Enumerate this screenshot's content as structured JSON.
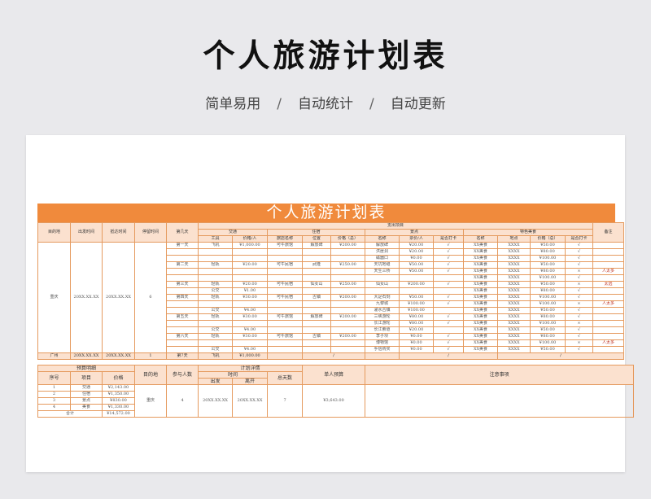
{
  "banner": {
    "title": "个人旅游计划表",
    "subtitle_items": [
      "简单易用",
      "自动统计",
      "自动更新"
    ],
    "separator": "/"
  },
  "doc": {
    "title": "个人旅游计划表",
    "headers": {
      "destination": "目的地",
      "depart_time": "出发时间",
      "arrive_time": "抵达时间",
      "stay_time": "停留时间",
      "day_no": "第几天",
      "expense": "支出项目",
      "transport": "交通",
      "lodging": "住宿",
      "scenic": "景点",
      "food": "特色美食",
      "note": "备注",
      "tool": "工具",
      "price_per": "价格/人",
      "hotel_name": "旅店名称",
      "location": "位置",
      "price_total": "价格（总）",
      "name": "名称",
      "ticket_per": "票价/人",
      "checked_in": "是否打卡",
      "place": "地点"
    },
    "group": {
      "destination": "重庆",
      "depart": "20XX.XX.XX",
      "arrive": "20XX.XX.XX",
      "stay": "6"
    },
    "rows": [
      {
        "day": "第一天",
        "tool": "飞机",
        "tprice": "¥1,000.00",
        "hotel": "可牛旅馆",
        "loc": "解放碑",
        "hprice": "¥200.00",
        "sname": "解放碑",
        "sprice": "¥20.00",
        "scheck": "√",
        "fname": "XX美食",
        "fplace": "XXXX",
        "fprice": "¥50.00",
        "fcheck": "√",
        "note": ""
      },
      {
        "day": "",
        "tool": "",
        "tprice": "",
        "hotel": "",
        "loc": "",
        "hprice": "",
        "sname": "洪崖洞",
        "sprice": "¥20.00",
        "scheck": "√",
        "fname": "XX美食",
        "fplace": "XXXX",
        "fprice": "¥80.00",
        "fcheck": "√",
        "note": ""
      },
      {
        "day": "",
        "tool": "",
        "tprice": "",
        "hotel": "",
        "loc": "",
        "hprice": "",
        "sname": "磁器口",
        "sprice": "¥0.00",
        "scheck": "√",
        "fname": "XX美食",
        "fplace": "XXXX",
        "fprice": "¥100.00",
        "fcheck": "√",
        "note": ""
      },
      {
        "day": "第二天",
        "tool": "轻轨",
        "tprice": "¥20.00",
        "hotel": "可牛民宿",
        "loc": "武隆",
        "hprice": "¥250.00",
        "sname": "天坑地缝",
        "sprice": "¥50.00",
        "scheck": "√",
        "fname": "XX美食",
        "fplace": "XXXX",
        "fprice": "¥50.00",
        "fcheck": "√",
        "note": ""
      },
      {
        "day": "",
        "tool": "",
        "tprice": "",
        "hotel": "",
        "loc": "",
        "hprice": "",
        "sname": "天生三桥",
        "sprice": "¥50.00",
        "scheck": "√",
        "fname": "XX美食",
        "fplace": "XXXX",
        "fprice": "¥80.00",
        "fcheck": "×",
        "note": "人太多"
      },
      {
        "day": "",
        "tool": "",
        "tprice": "",
        "hotel": "",
        "loc": "",
        "hprice": "",
        "sname": "",
        "sprice": "",
        "scheck": "",
        "fname": "XX美食",
        "fplace": "XXXX",
        "fprice": "¥100.00",
        "fcheck": "√",
        "note": ""
      },
      {
        "day": "第三天",
        "tool": "轻轨",
        "tprice": "¥20.00",
        "hotel": "可牛民宿",
        "loc": "仙女山",
        "hprice": "¥250.00",
        "sname": "仙女山",
        "sprice": "¥200.00",
        "scheck": "√",
        "fname": "XX美食",
        "fplace": "XXXX",
        "fprice": "¥50.00",
        "fcheck": "×",
        "note": "太远"
      },
      {
        "day": "",
        "tool": "公交",
        "tprice": "¥1.00",
        "hotel": "",
        "loc": "",
        "hprice": "",
        "sname": "",
        "sprice": "",
        "scheck": "",
        "fname": "XX美食",
        "fplace": "XXXX",
        "fprice": "¥80.00",
        "fcheck": "√",
        "note": ""
      },
      {
        "day": "第四天",
        "tool": "轻轨",
        "tprice": "¥30.00",
        "hotel": "可牛民宿",
        "loc": "古镇",
        "hprice": "¥200.00",
        "sname": "大足石刻",
        "sprice": "¥50.00",
        "scheck": "√",
        "fname": "XX美食",
        "fplace": "XXXX",
        "fprice": "¥100.00",
        "fcheck": "√",
        "note": ""
      },
      {
        "day": "",
        "tool": "",
        "tprice": "",
        "hotel": "",
        "loc": "",
        "hprice": "",
        "sname": "九黎城",
        "sprice": "¥100.00",
        "scheck": "√",
        "fname": "XX美食",
        "fplace": "XXXX",
        "fprice": "¥100.00",
        "fcheck": "×",
        "note": "人太多"
      },
      {
        "day": "",
        "tool": "公交",
        "tprice": "¥4.00",
        "hotel": "",
        "loc": "",
        "hprice": "",
        "sname": "濯水古镇",
        "sprice": "¥100.00",
        "scheck": "",
        "fname": "XX美食",
        "fplace": "XXXX",
        "fprice": "¥50.00",
        "fcheck": "√",
        "note": ""
      },
      {
        "day": "第五天",
        "tool": "轻轨",
        "tprice": "¥30.00",
        "hotel": "可牛旅馆",
        "loc": "解放碑",
        "hprice": "¥200.00",
        "sname": "三峡游轮",
        "sprice": "¥80.00",
        "scheck": "√",
        "fname": "XX美食",
        "fplace": "XXXX",
        "fprice": "¥80.00",
        "fcheck": "√",
        "note": ""
      },
      {
        "day": "",
        "tool": "",
        "tprice": "",
        "hotel": "",
        "loc": "",
        "hprice": "",
        "sname": "长江游轮",
        "sprice": "¥80.00",
        "scheck": "√",
        "fname": "XX美食",
        "fplace": "XXXX",
        "fprice": "¥100.00",
        "fcheck": "×",
        "note": ""
      },
      {
        "day": "",
        "tool": "公交",
        "tprice": "¥4.00",
        "hotel": "",
        "loc": "",
        "hprice": "",
        "sname": "长江索道",
        "sprice": "¥20.00",
        "scheck": "",
        "fname": "XX美食",
        "fplace": "XXXX",
        "fprice": "¥50.00",
        "fcheck": "√",
        "note": ""
      },
      {
        "day": "第六天",
        "tool": "轻轨",
        "tprice": "¥30.00",
        "hotel": "可牛旅馆",
        "loc": "古镇",
        "hprice": "¥200.00",
        "sname": "李子坝",
        "sprice": "¥0.00",
        "scheck": "√",
        "fname": "XX美食",
        "fplace": "XXXX",
        "fprice": "¥80.00",
        "fcheck": "√",
        "note": ""
      },
      {
        "day": "",
        "tool": "",
        "tprice": "",
        "hotel": "",
        "loc": "",
        "hprice": "",
        "sname": "博物馆",
        "sprice": "¥0.00",
        "scheck": "√",
        "fname": "XX美食",
        "fplace": "XXXX",
        "fprice": "¥100.00",
        "fcheck": "×",
        "note": "人太多"
      },
      {
        "day": "",
        "tool": "公交",
        "tprice": "¥4.00",
        "hotel": "",
        "loc": "",
        "hprice": "",
        "sname": "手信购买",
        "sprice": "¥0.00",
        "scheck": "√",
        "fname": "XX美食",
        "fplace": "XXXX",
        "fprice": "¥50.00",
        "fcheck": "√",
        "note": ""
      }
    ],
    "last_row": {
      "destination": "广州",
      "depart": "20XX.XX.XX",
      "arrive": "20XX.XX.XX",
      "stay": "1",
      "day": "第7天",
      "tool": "飞机",
      "tprice": "¥1,000.00",
      "slash": "/"
    },
    "budget": {
      "header": "预算明细",
      "cols": [
        "序号",
        "项目",
        "价格"
      ],
      "items": [
        {
          "no": "1",
          "item": "交通",
          "price": "¥2,143.00"
        },
        {
          "no": "2",
          "item": "住宿",
          "price": "¥1,350.00"
        },
        {
          "no": "3",
          "item": "景点",
          "price": "¥830.00"
        },
        {
          "no": "4",
          "item": "美食",
          "price": "¥1,330.00"
        }
      ],
      "total_label": "合计",
      "total": "¥14,572.00"
    },
    "plan": {
      "destination_label": "目的地",
      "people_label": "参与人数",
      "detail_label": "计划详情",
      "time_label": "时间",
      "depart_label": "出发",
      "leave_label": "离开",
      "days_label": "总天数",
      "budget_label": "单人预算",
      "notes_label": "注意事项",
      "destination": "重庆",
      "people": "4",
      "depart": "20XX.XX.XX",
      "leave": "20XX.XX.XX",
      "days": "7",
      "per_person": "¥3,643.00"
    }
  }
}
